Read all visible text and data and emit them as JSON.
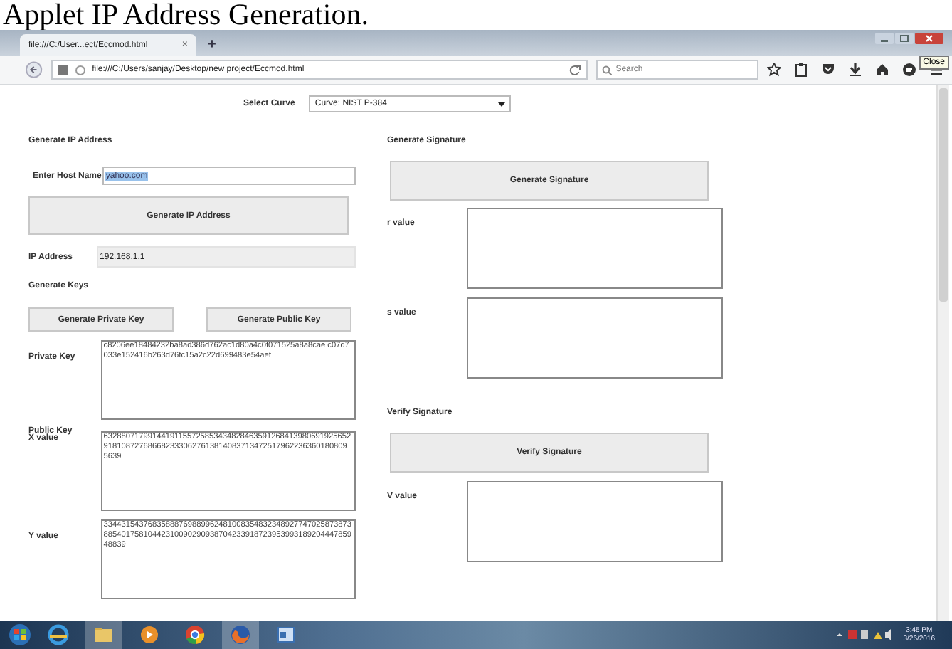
{
  "caption": "Applet IP Address Generation.",
  "browser": {
    "tab": {
      "title": "file:///C:/User...ect/Eccmod.html",
      "close": "×"
    },
    "new_tab": "+",
    "tooltip": "Close",
    "address": "file:///C:/Users/sanjay/Desktop/new project/Eccmod.html",
    "search": {
      "placeholder": "Search"
    }
  },
  "curve": {
    "label": "Select Curve",
    "value": "Curve: NIST P-384"
  },
  "ip_section": {
    "title": "Generate IP Address",
    "host_label": "Enter Host Name",
    "host_value": "yahoo.com",
    "host_selected": true,
    "button": "Generate IP Address",
    "ip_label": "IP Address",
    "ip_value": "192.168.1.1"
  },
  "keys_section": {
    "title": "Generate Keys",
    "buttons": [
      "Generate Private Key",
      "Generate Public Key"
    ],
    "private_label": "Private Key",
    "private_value": "c8206ee18484232ba8ad386d762ac1d80a4c0f071525a8a8cae c07d7033e152416b263d76fc15a2c22d699483e54aef",
    "public_label": "Public Key",
    "x_label": "X value",
    "x_value": "632880717991441911557258534348284635912684139806919256529181087276866823330627613814083713472517962236360180809 5639",
    "y_label": "Y value",
    "y_value": "334431543768358887698899624810083548323489277470258738738854017581044231009029093870423391872395399318920444785948839"
  },
  "signature_section": {
    "title": "Generate Signature",
    "button": "Generate Signature",
    "r_label": "r value",
    "s_label": "s value"
  },
  "verify_section": {
    "title": "Verify Signature",
    "button": "Verify Signature",
    "v_label": "V value"
  },
  "taskbar": {
    "time": "3:45 PM",
    "date": "3/26/2016"
  }
}
